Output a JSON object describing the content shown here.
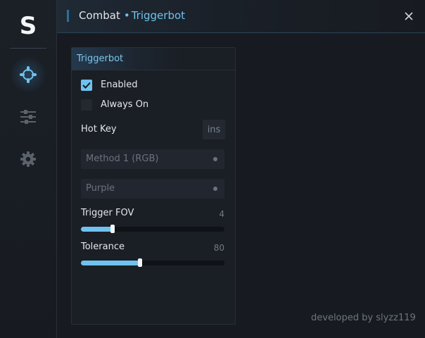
{
  "app": {
    "logo_letter": "S"
  },
  "sidebar": {
    "items": [
      {
        "id": "combat",
        "icon": "crosshair-icon",
        "active": true
      },
      {
        "id": "adjust",
        "icon": "sliders-icon",
        "active": false
      },
      {
        "id": "settings",
        "icon": "gear-icon",
        "active": false
      }
    ]
  },
  "header": {
    "section": "Combat",
    "separator": "•",
    "subsection": "Triggerbot",
    "close_icon": "close-icon"
  },
  "panel": {
    "title": "Triggerbot",
    "enabled": {
      "label": "Enabled",
      "checked": true
    },
    "always_on": {
      "label": "Always On",
      "checked": false
    },
    "hotkey": {
      "label": "Hot Key",
      "value": "ins"
    },
    "method": {
      "value": "Method 1 (RGB)"
    },
    "color": {
      "value": "Purple"
    },
    "trigger_fov": {
      "label": "Trigger FOV",
      "value": "4",
      "fill_fraction": 0.22
    },
    "tolerance": {
      "label": "Tolerance",
      "value": "80",
      "fill_fraction": 0.41
    }
  },
  "footer": {
    "credit": "developed by slyzz119"
  },
  "colors": {
    "accent": "#6fc2ef",
    "background": "#171b21",
    "panel": "#1a1e25"
  }
}
